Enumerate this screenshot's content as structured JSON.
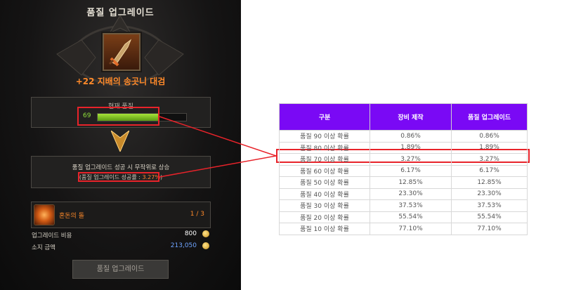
{
  "panel": {
    "title": "품질 업그레이드",
    "item_icon": "dagger-icon",
    "item_name": "+22 지배의 송곳니 대검",
    "current_quality": {
      "label": "현재 품질",
      "value": "69",
      "fraction": 0.69
    },
    "upgrade_box": {
      "text": "품질 업그레이드 성공 시 무작위로 상승",
      "rate_prefix": "(품질 업그레이드 성공률 : ",
      "rate_value": "3.27%",
      "rate_suffix": ")"
    },
    "material": {
      "name": "혼돈의 돌",
      "count": "1 / 3",
      "icon": "chaos-stone-icon"
    },
    "cost": {
      "label": "업그레이드 비용",
      "value": "800",
      "color": "#ffffff"
    },
    "owned": {
      "label": "소지 금액",
      "value": "213,050",
      "color": "#6fa4ff"
    },
    "button_label": "품질 업그레이드"
  },
  "highlight_color": "#e8232a",
  "table": {
    "header_color": "#7a09f5",
    "headers": [
      "구분",
      "장비 제작",
      "품질 업그레이드"
    ],
    "rows": [
      [
        "품질 90 이상 확률",
        "0.86%",
        "0.86%"
      ],
      [
        "품질 80 이상 확률",
        "1.89%",
        "1.89%"
      ],
      [
        "품질 70 이상 확률",
        "3.27%",
        "3.27%"
      ],
      [
        "품질 60 이상 확률",
        "6.17%",
        "6.17%"
      ],
      [
        "품질 50 이상 확률",
        "12.85%",
        "12.85%"
      ],
      [
        "품질 40 이상 확률",
        "23.30%",
        "23.30%"
      ],
      [
        "품질 30 이상 확률",
        "37.53%",
        "37.53%"
      ],
      [
        "품질 20 이상 확률",
        "55.54%",
        "55.54%"
      ],
      [
        "품질 10 이상 확률",
        "77.10%",
        "77.10%"
      ]
    ]
  }
}
